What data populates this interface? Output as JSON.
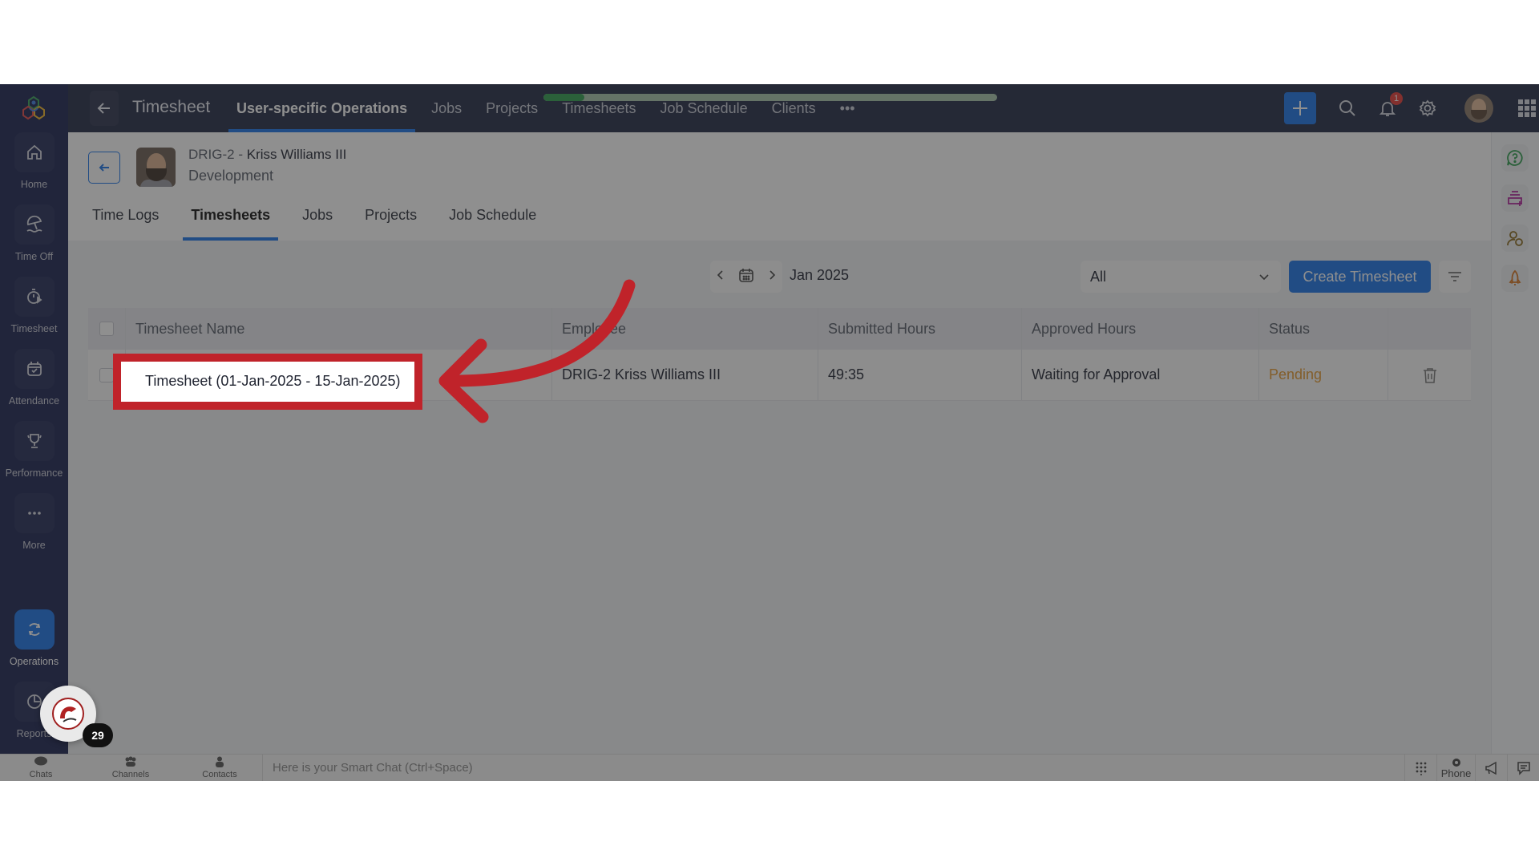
{
  "sidebar": {
    "items": [
      {
        "label": "Home",
        "icon": "home-icon"
      },
      {
        "label": "Time Off",
        "icon": "beach-umbrella-icon"
      },
      {
        "label": "Timesheet",
        "icon": "stopwatch-icon"
      },
      {
        "label": "Attendance",
        "icon": "calendar-check-icon"
      },
      {
        "label": "Performance",
        "icon": "trophy-icon"
      },
      {
        "label": "More",
        "icon": "more-dots-icon"
      },
      {
        "label": "Operations",
        "icon": "operations-icon",
        "active": true
      },
      {
        "label": "Reports",
        "icon": "pie-chart-icon"
      }
    ]
  },
  "topbar": {
    "title": "Timesheet",
    "tabs": [
      {
        "label": "User-specific Operations",
        "active": true
      },
      {
        "label": "Jobs"
      },
      {
        "label": "Projects"
      },
      {
        "label": "Timesheets"
      },
      {
        "label": "Job Schedule"
      },
      {
        "label": "Clients"
      },
      {
        "label": "•••"
      }
    ],
    "progress_fraction": 0.09,
    "notification_count": "1"
  },
  "employee": {
    "id_prefix": "DRIG-2 - ",
    "name": "Kriss Williams III",
    "department": "Development"
  },
  "subtabs": [
    {
      "label": "Time Logs"
    },
    {
      "label": "Timesheets",
      "active": true
    },
    {
      "label": "Jobs"
    },
    {
      "label": "Projects"
    },
    {
      "label": "Job Schedule"
    }
  ],
  "toolbar": {
    "period": "Jan 2025",
    "filter_value": "All",
    "create_label": "Create Timesheet"
  },
  "table": {
    "headers": [
      "Timesheet Name",
      "Employee",
      "Submitted Hours",
      "Approved Hours",
      "Status"
    ],
    "rows": [
      {
        "name": "Timesheet (01-Jan-2025 - 15-Jan-2025)",
        "employee": "DRIG-2 Kriss Williams III",
        "submitted": "49:35",
        "approved": "Waiting for Approval",
        "status": "Pending"
      }
    ]
  },
  "chat_float": {
    "count": "29"
  },
  "bottombar": {
    "items": [
      "Chats",
      "Channels",
      "Contacts"
    ],
    "smart_chat_placeholder": "Here is your Smart Chat (Ctrl+Space)",
    "phone_label": "Phone"
  },
  "colors": {
    "accent": "#1a73e8",
    "sidebar": "#1b2250",
    "topbar": "#222a45",
    "status_pending": "#e59a2f",
    "annotation": "#c0232a"
  }
}
